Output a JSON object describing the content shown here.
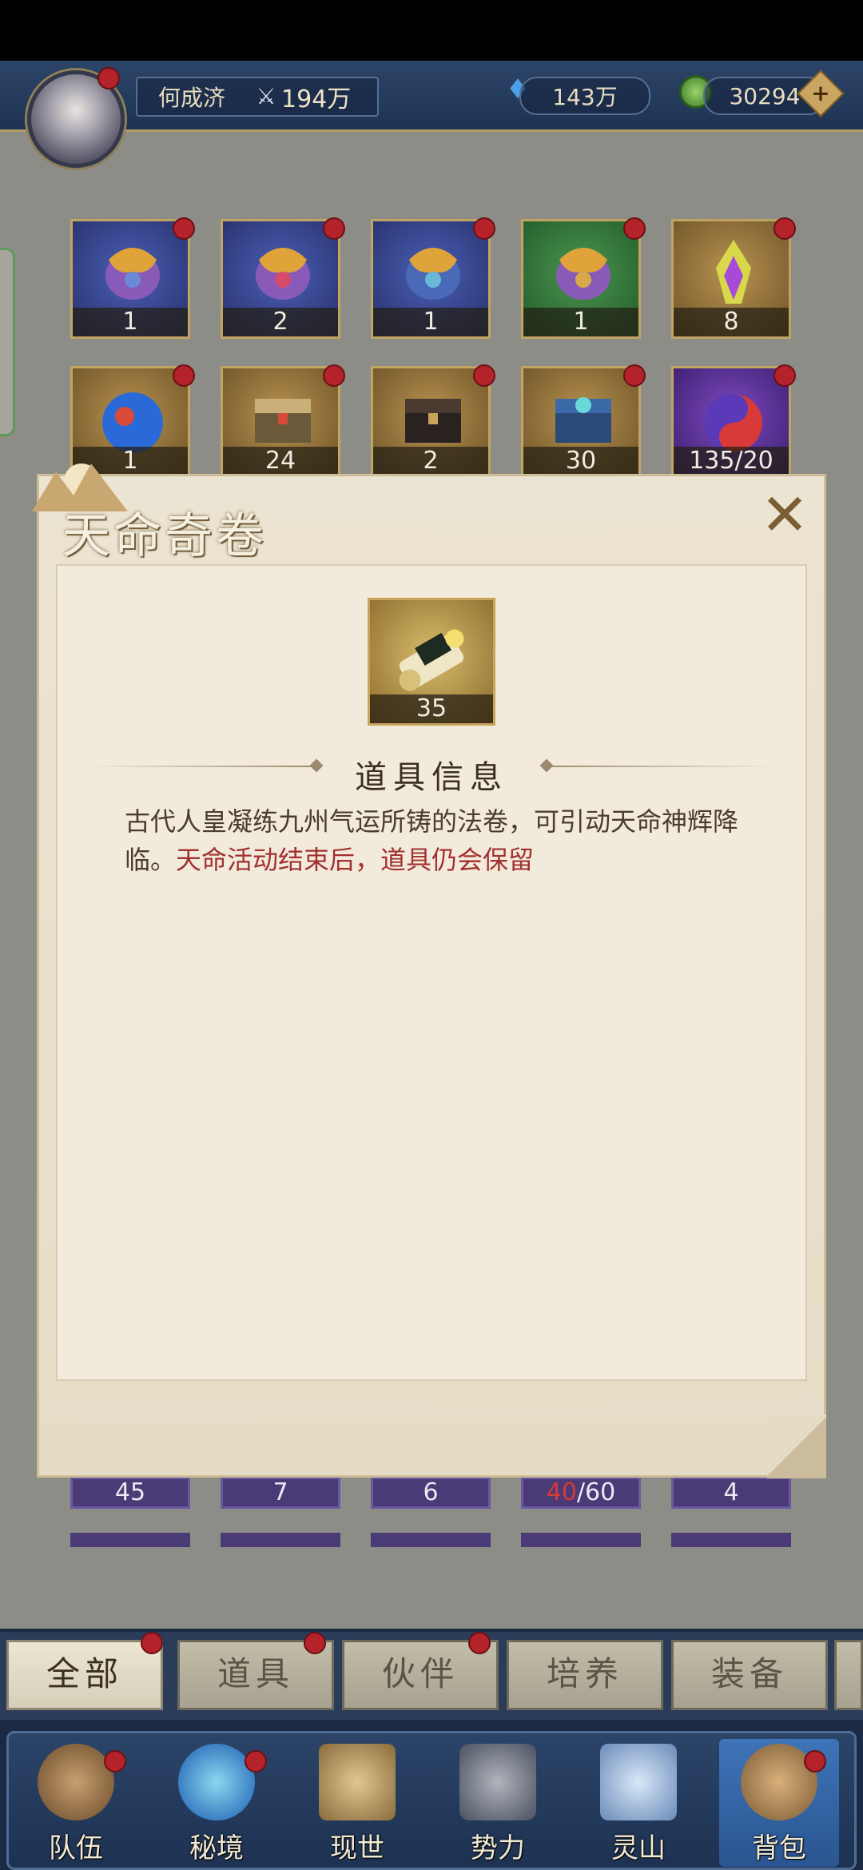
{
  "player": {
    "name": "何成济",
    "power": "194万"
  },
  "currency": {
    "gems": "143万",
    "jade": "30294"
  },
  "inventory_top": [
    {
      "count": "1",
      "rarity": "blue"
    },
    {
      "count": "2",
      "rarity": "blue"
    },
    {
      "count": "1",
      "rarity": "blue"
    },
    {
      "count": "1",
      "rarity": "green"
    },
    {
      "count": "8",
      "rarity": "gold"
    }
  ],
  "inventory_second": [
    {
      "count": "1",
      "rarity": "gold"
    },
    {
      "count": "24",
      "rarity": "gold"
    },
    {
      "count": "2",
      "rarity": "gold"
    },
    {
      "count": "30",
      "rarity": "gold"
    },
    {
      "count": "135/20",
      "rarity": "purple"
    }
  ],
  "inventory_lower": {
    "c1": "45",
    "c2": "7",
    "c3": "6",
    "c4_current": "40",
    "c4_total": "/60",
    "c5": "4"
  },
  "dialog": {
    "title": "天命奇卷",
    "item_count": "35",
    "section_title": "道具信息",
    "description": "古代人皇凝练九州气运所铸的法卷，可引动天命神辉降临。",
    "note": "天命活动结束后，道具仍会保留"
  },
  "category_tabs": [
    "全部",
    "道具",
    "伙伴",
    "培养",
    "装备"
  ],
  "nav": [
    "队伍",
    "秘境",
    "现世",
    "势力",
    "灵山",
    "背包"
  ],
  "colors": {
    "accent_gold": "#c2a462",
    "warn_red": "#a23030",
    "badge_red": "#b4222a"
  }
}
